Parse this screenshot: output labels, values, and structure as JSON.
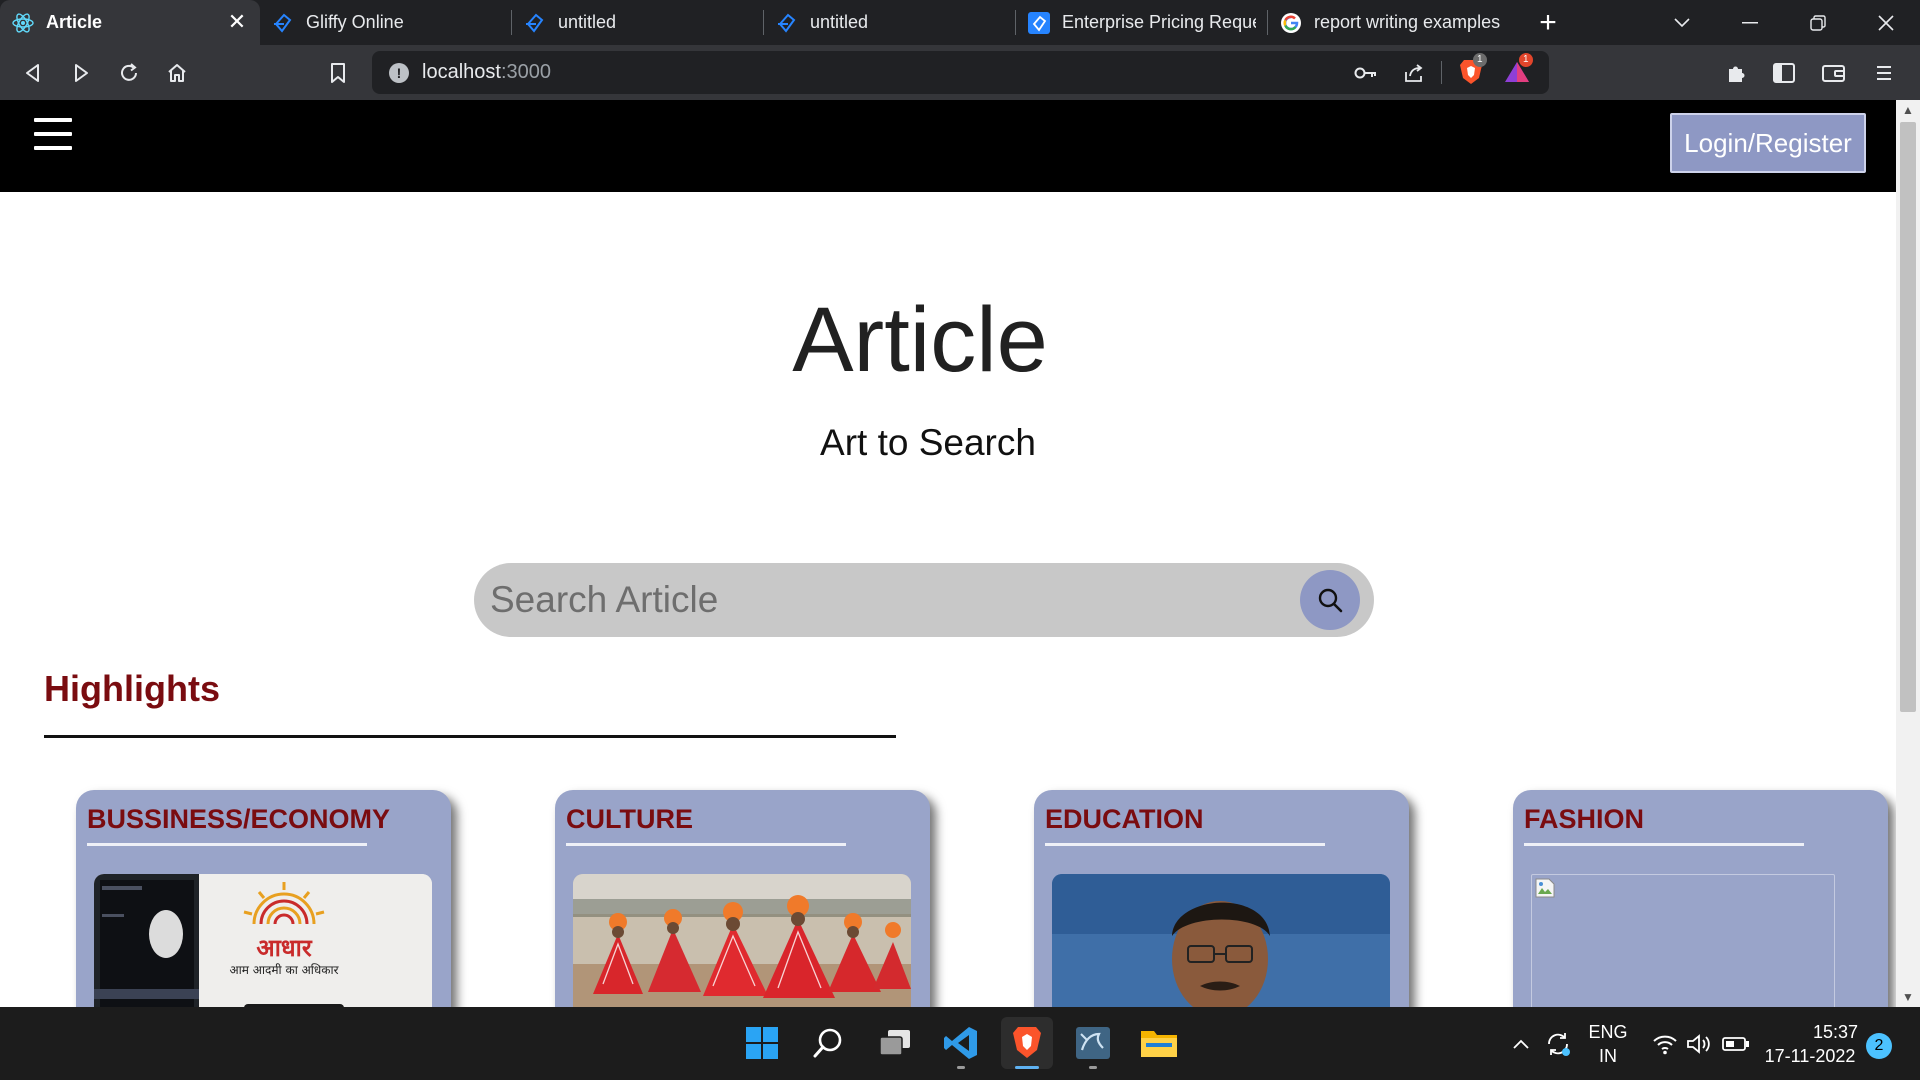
{
  "browser": {
    "tabs": [
      {
        "title": "Article",
        "icon": "react-icon",
        "active": true
      },
      {
        "title": "Gliffy Online",
        "icon": "gliffy-icon",
        "active": false
      },
      {
        "title": "untitled",
        "icon": "gliffy-icon",
        "active": false
      },
      {
        "title": "untitled",
        "icon": "gliffy-icon",
        "active": false
      },
      {
        "title": "Enterprise Pricing Reque",
        "icon": "gliffy-enterprise-icon",
        "active": false
      },
      {
        "title": "report writing examples",
        "icon": "google-icon",
        "active": false
      }
    ],
    "close_symbol": "✕",
    "new_tab_symbol": "+",
    "url_host": "localhost",
    "url_port": ":3000",
    "brave_shield_count": "1",
    "rewards_count": "1"
  },
  "navbar": {
    "login_label": "Login/Register"
  },
  "hero": {
    "title": "Article",
    "subtitle": "Art to Search"
  },
  "search": {
    "placeholder": "Search Article"
  },
  "highlights": {
    "heading": "Highlights",
    "cards": [
      {
        "category": "BUSSINESS/ECONOMY",
        "image": "aadhaar-photo"
      },
      {
        "category": "CULTURE",
        "image": "rajasthani-dancers-photo"
      },
      {
        "category": "EDUCATION",
        "image": "minister-press-photo"
      },
      {
        "category": "FASHION",
        "image": "broken-image"
      }
    ]
  },
  "aadhaar_caption": "आधार",
  "aadhaar_tagline": "आम आदमी का अधिकार",
  "taskbar": {
    "language": "ENG",
    "region": "IN",
    "time": "15:37",
    "date": "17-11-2022",
    "notifications": "2"
  },
  "colors": {
    "accent": "#8e98c4",
    "card_bg": "#99a4c9",
    "heading_red": "#7a0c10",
    "navbar": "#000000"
  }
}
